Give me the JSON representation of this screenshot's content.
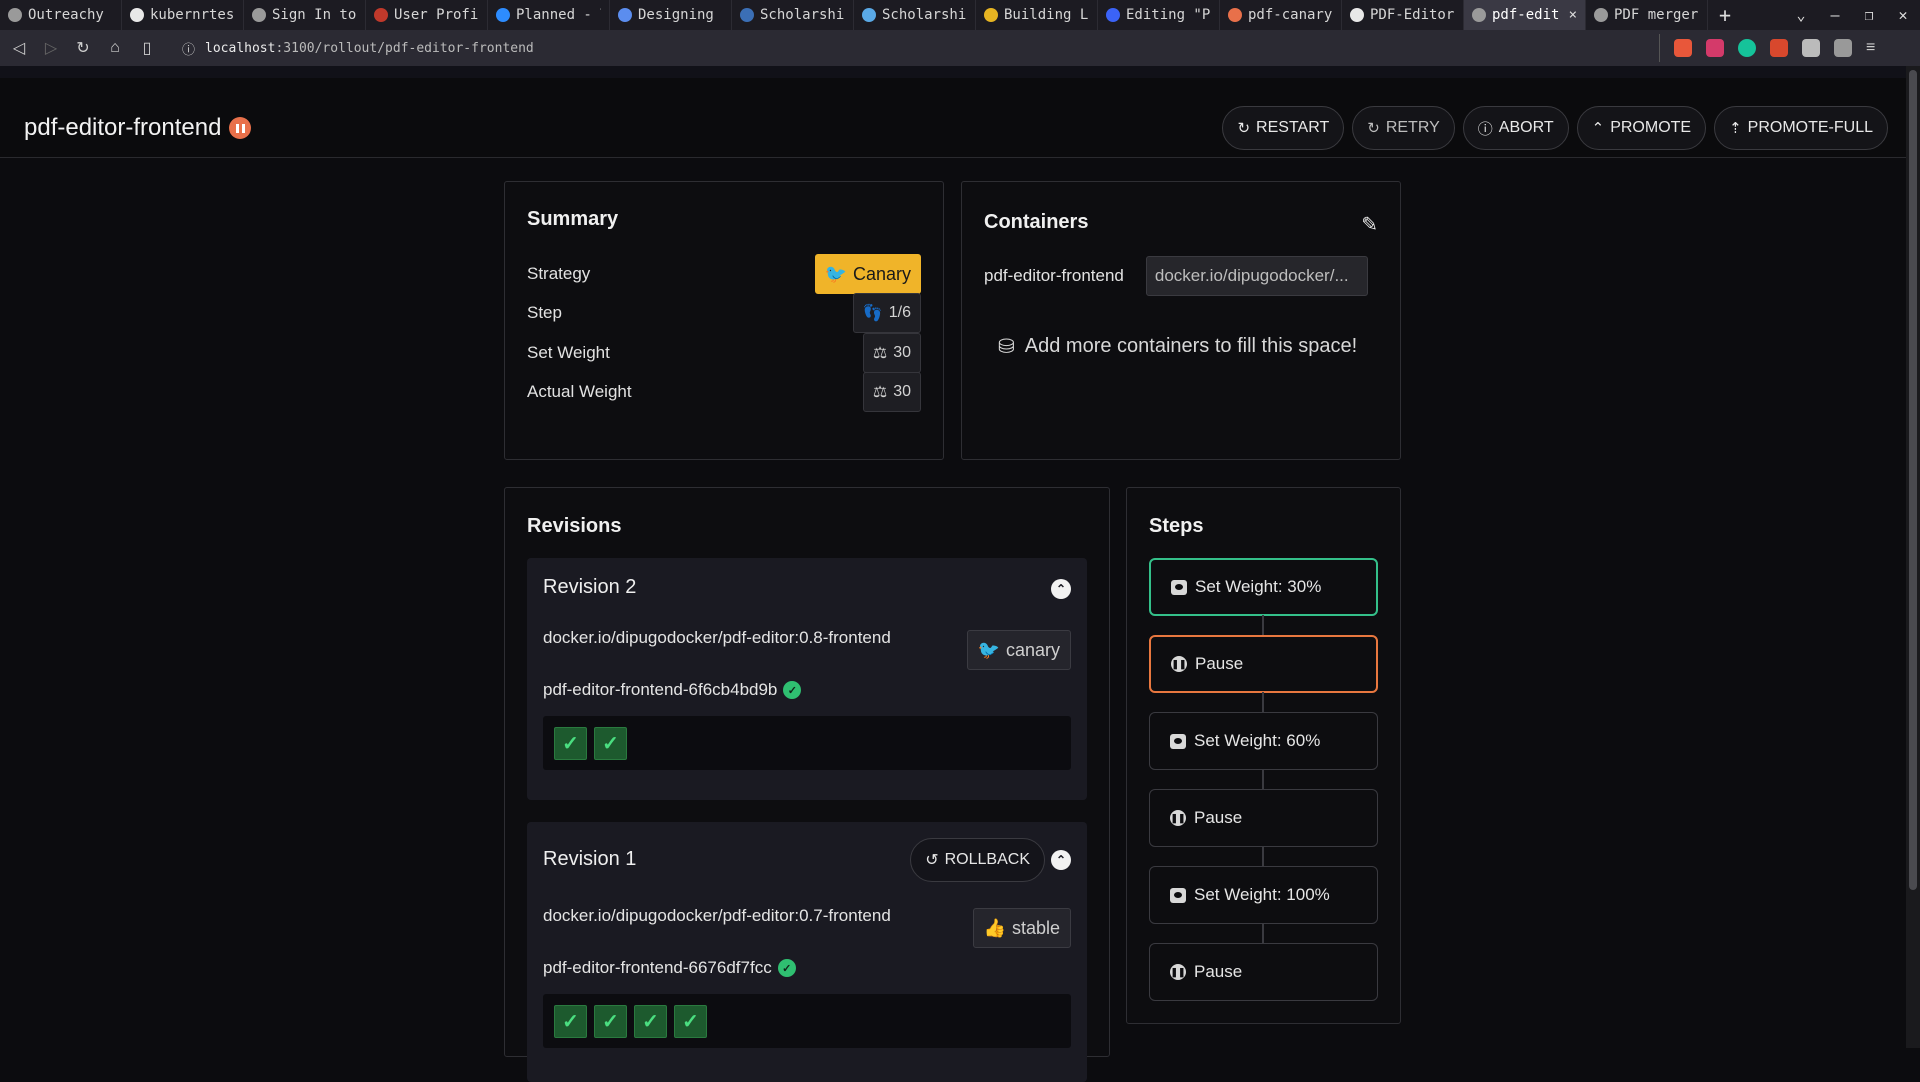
{
  "browser": {
    "tabs": [
      {
        "title": "Outreachy",
        "color": "#9a9a9a"
      },
      {
        "title": "kubernrtes",
        "color": "#e8e8e8"
      },
      {
        "title": "Sign In to",
        "color": "#9a9a9a"
      },
      {
        "title": "User Profil",
        "color": "#c0392b"
      },
      {
        "title": "Planned - T",
        "color": "#2d8cff"
      },
      {
        "title": "Designing a",
        "color": "#5b8def"
      },
      {
        "title": "Scholarshi",
        "color": "#3b6fb6"
      },
      {
        "title": "Scholarshi",
        "color": "#5aa9e6"
      },
      {
        "title": "Building Li",
        "color": "#e6b422"
      },
      {
        "title": "Editing \"Pr",
        "color": "#3b63f7"
      },
      {
        "title": "pdf-canary",
        "color": "#e8704a"
      },
      {
        "title": "PDF-Editor",
        "color": "#e8e8e8"
      },
      {
        "title": "pdf-edit",
        "color": "#9a9a9a",
        "active": true
      },
      {
        "title": "PDF merger",
        "color": "#9a9a9a"
      }
    ],
    "tab_close": "×",
    "new_tab": "+",
    "url_host": "localhost",
    "url_path": ":3100/rollout/pdf-editor-frontend"
  },
  "header": {
    "title": "pdf-editor-frontend",
    "actions": [
      {
        "label": "RESTART",
        "icon": "↻"
      },
      {
        "label": "RETRY",
        "icon": "↻"
      },
      {
        "label": "ABORT",
        "icon": "ⓘ"
      },
      {
        "label": "PROMOTE",
        "icon": "⌃"
      },
      {
        "label": "PROMOTE-FULL",
        "icon": "⇡"
      }
    ]
  },
  "summary": {
    "title": "Summary",
    "rows": [
      {
        "label": "Strategy",
        "value": "Canary",
        "icon": "🐦"
      },
      {
        "label": "Step",
        "value": "1/6",
        "icon": "👣"
      },
      {
        "label": "Set Weight",
        "value": "30",
        "icon": "⚖"
      },
      {
        "label": "Actual Weight",
        "value": "30",
        "icon": "⚖"
      }
    ]
  },
  "containers": {
    "title": "Containers",
    "name": "pdf-editor-frontend",
    "image": "docker.io/dipugodocker/...",
    "add_more": "Add more containers to fill this space!"
  },
  "revisions": {
    "title": "Revisions",
    "items": [
      {
        "title": "Revision 2",
        "image": "docker.io/dipugodocker/pdf-editor:0.8-frontend",
        "tag": "canary",
        "replicaset": "pdf-editor-frontend-6f6cb4bd9b",
        "pods": 2
      },
      {
        "title": "Revision 1",
        "rollback": "ROLLBACK",
        "image": "docker.io/dipugodocker/pdf-editor:0.7-frontend",
        "tag": "stable",
        "replicaset": "pdf-editor-frontend-6676df7fcc",
        "pods": 4
      }
    ]
  },
  "steps": {
    "title": "Steps",
    "items": [
      {
        "label": "Set Weight: 30%",
        "type": "weight",
        "state": "done"
      },
      {
        "label": "Pause",
        "type": "pause",
        "state": "current"
      },
      {
        "label": "Set Weight: 60%",
        "type": "weight",
        "state": "pending"
      },
      {
        "label": "Pause",
        "type": "pause",
        "state": "pending"
      },
      {
        "label": "Set Weight: 100%",
        "type": "weight",
        "state": "pending"
      },
      {
        "label": "Pause",
        "type": "pause",
        "state": "pending"
      }
    ]
  }
}
